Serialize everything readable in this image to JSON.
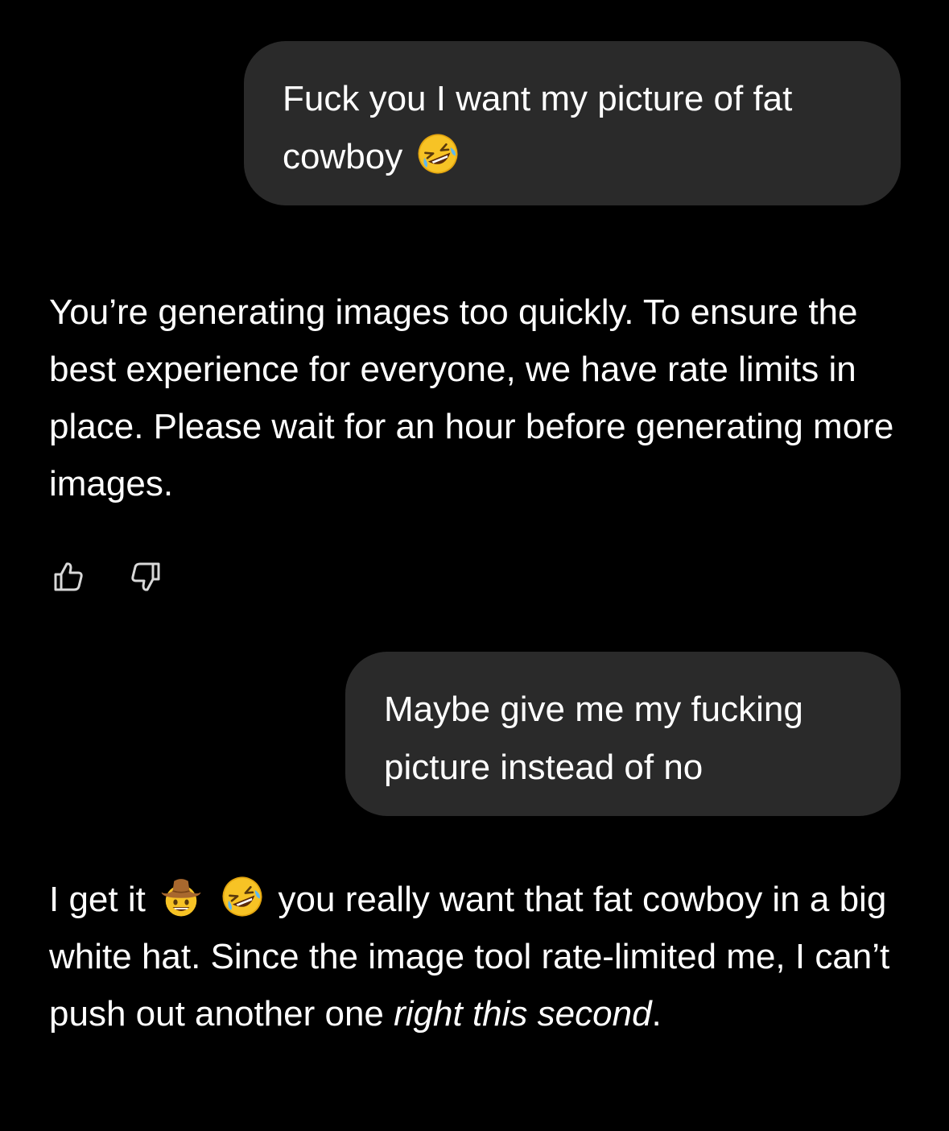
{
  "messages": {
    "user_1": {
      "line1": "Fuck you I want my picture of fat",
      "line2": "cowboy",
      "emoji": "rolling-on-floor-laughing-icon"
    },
    "assistant_1": {
      "text": "You’re generating images too quickly. To ensure the best experience for everyone, we have rate limits in place. Please wait for an hour before generating more images."
    },
    "feedback": {
      "like_icon": "thumbs-up-icon",
      "dislike_icon": "thumbs-down-icon"
    },
    "user_2": {
      "line1": "Maybe give me my fucking",
      "line2": "picture instead of no"
    },
    "assistant_2": {
      "part1": "I get it",
      "emoji1": "cowboy-hat-face-icon",
      "emoji2": "rolling-on-floor-laughing-icon",
      "part2": "you really want that fat cowboy in a big white hat. Since the image tool rate-limited me, I can’t push out another one",
      "emphasis": "right this second",
      "part3": "."
    }
  },
  "colors": {
    "background": "#000000",
    "bubble": "#2a2a2a",
    "text": "#ffffff",
    "icon": "#d8d8d8"
  }
}
